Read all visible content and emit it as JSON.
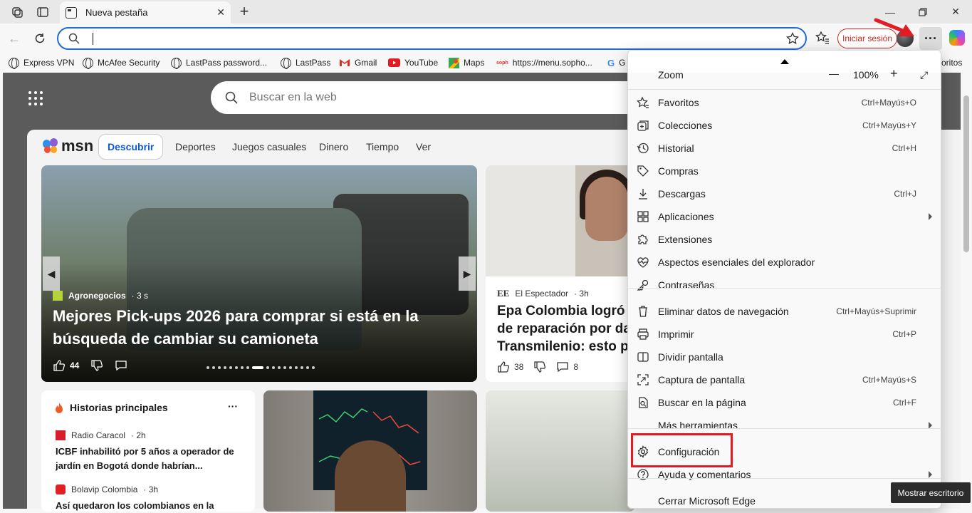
{
  "tab": {
    "title": "Nueva pestaña"
  },
  "addressbar": {
    "value": "",
    "placeholder": ""
  },
  "toolbar": {
    "signin_label": "Iniciar sesión",
    "more_label": "···"
  },
  "bookmarks": [
    {
      "label": "Express VPN",
      "icon": "globe-icon"
    },
    {
      "label": "McAfee Security",
      "icon": "globe-icon"
    },
    {
      "label": "LastPass password...",
      "icon": "globe-icon"
    },
    {
      "label": "LastPass",
      "icon": "globe-icon"
    },
    {
      "label": "Gmail",
      "icon": "gmail-icon"
    },
    {
      "label": "YouTube",
      "icon": "youtube-icon"
    },
    {
      "label": "Maps",
      "icon": "maps-icon"
    },
    {
      "label": "https://menu.sopho...",
      "icon": "sophos-icon"
    },
    {
      "label": "G",
      "icon": "google-icon"
    },
    {
      "label": "oritos",
      "icon": "folder-icon"
    }
  ],
  "websearch": {
    "placeholder": "Buscar en la web"
  },
  "msn": {
    "logo": "msn",
    "nav": [
      "Descubrir",
      "Deportes",
      "Juegos casuales",
      "Dinero",
      "Tiempo",
      "Ver"
    ],
    "hero": {
      "source": "Agronegocios",
      "age": "· 3 s",
      "title": "Mejores Pick-ups 2026 para comprar si está en la búsqueda de cambiar su camioneta",
      "likes": "44"
    },
    "card2": {
      "source": "El Espectador",
      "age": "· 3h",
      "title_lines": [
        "Epa Colombia logró",
        "de reparación por da",
        "Transmilenio: esto pa"
      ],
      "likes": "38",
      "comments": "8"
    },
    "stories": {
      "title": "Historias principales",
      "more": "···",
      "items": [
        {
          "source": "Radio Caracol",
          "age": "· 2h",
          "title": "ICBF inhabilitó por 5 años a operador de jardín en Bogotá donde habrían..."
        },
        {
          "source": "Bolavip Colombia",
          "age": "· 3h",
          "title": "Así quedaron los colombianos en la"
        }
      ]
    }
  },
  "menu": {
    "zoom": {
      "label": "Zoom",
      "value": "100%",
      "minus": "—",
      "plus": "+"
    },
    "items": [
      {
        "label": "Favoritos",
        "shortcut": "Ctrl+Mayús+O",
        "icon": "star-list-icon"
      },
      {
        "label": "Colecciones",
        "shortcut": "Ctrl+Mayús+Y",
        "icon": "collections-icon"
      },
      {
        "label": "Historial",
        "shortcut": "Ctrl+H",
        "icon": "history-icon"
      },
      {
        "label": "Compras",
        "shortcut": "",
        "icon": "tag-icon"
      },
      {
        "label": "Descargas",
        "shortcut": "Ctrl+J",
        "icon": "download-icon"
      },
      {
        "label": "Aplicaciones",
        "shortcut": "",
        "icon": "apps-icon",
        "submenu": true
      },
      {
        "label": "Extensiones",
        "shortcut": "",
        "icon": "puzzle-icon"
      },
      {
        "label": "Aspectos esenciales del explorador",
        "shortcut": "",
        "icon": "heart-pulse-icon"
      },
      {
        "label": "Contraseñas",
        "shortcut": "",
        "icon": "key-icon"
      },
      {
        "label": "Eliminar datos de navegación",
        "shortcut": "Ctrl+Mayús+Suprimir",
        "icon": "trash-icon"
      },
      {
        "label": "Imprimir",
        "shortcut": "Ctrl+P",
        "icon": "printer-icon"
      },
      {
        "label": "Dividir pantalla",
        "shortcut": "",
        "icon": "split-screen-icon"
      },
      {
        "label": "Captura de pantalla",
        "shortcut": "Ctrl+Mayús+S",
        "icon": "screenshot-icon"
      },
      {
        "label": "Buscar en la página",
        "shortcut": "Ctrl+F",
        "icon": "find-icon"
      },
      {
        "label": "Más herramientas",
        "shortcut": "",
        "icon": "",
        "submenu": true
      },
      {
        "label": "Configuración",
        "shortcut": "",
        "icon": "gear-icon"
      },
      {
        "label": "Ayuda y comentarios",
        "shortcut": "",
        "icon": "help-icon",
        "submenu": true
      },
      {
        "label": "Cerrar Microsoft Edge",
        "shortcut": "",
        "icon": ""
      }
    ]
  },
  "tooltip": "Mostrar escritorio",
  "colors": {
    "accent": "#1f6bd6",
    "signin": "#c42b1c",
    "highlight": "#e31b23"
  }
}
